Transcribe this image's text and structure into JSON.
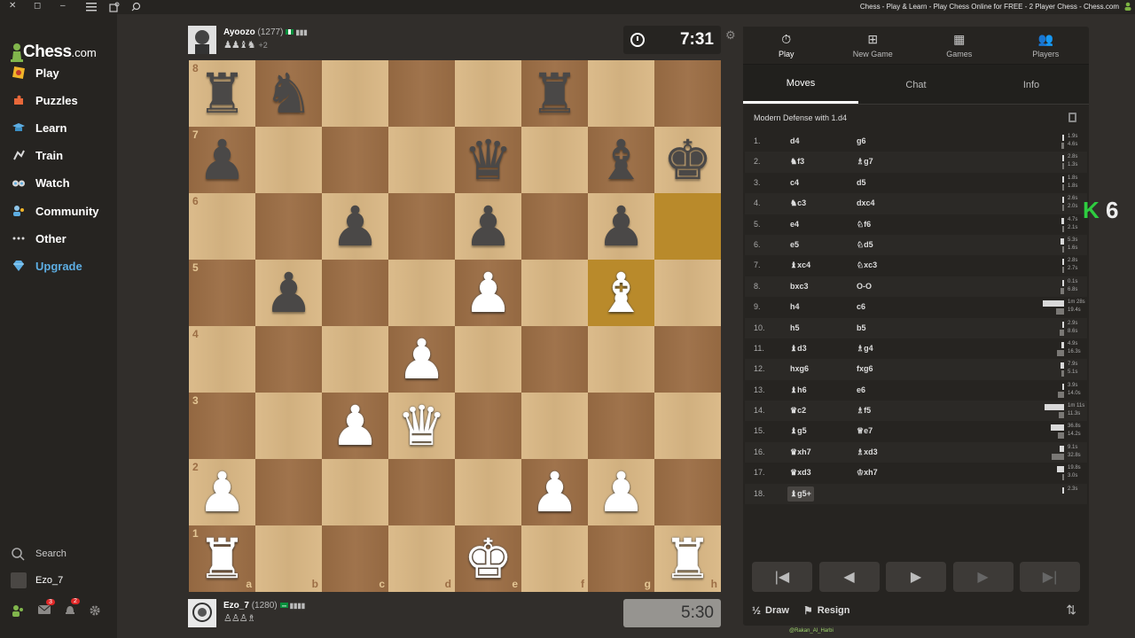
{
  "window": {
    "title": "Chess - Play & Learn - Play Chess Online for FREE - 2 Player Chess - Chess.com",
    "controls": [
      "✕",
      "◻",
      "–"
    ]
  },
  "sidebar": {
    "logo_text": "Chess",
    "logo_suffix": ".com",
    "items": [
      {
        "label": "Play",
        "icon": "play-icon",
        "color": "#f0b429"
      },
      {
        "label": "Puzzles",
        "icon": "puzzle-icon",
        "color": "#e8683a"
      },
      {
        "label": "Learn",
        "icon": "learn-icon",
        "color": "#5dade2"
      },
      {
        "label": "Train",
        "icon": "train-icon",
        "color": "#d9d9d9"
      },
      {
        "label": "Watch",
        "icon": "watch-icon",
        "color": "#d9d9d9"
      },
      {
        "label": "Community",
        "icon": "community-icon",
        "color": "#8ec5e8"
      },
      {
        "label": "Other",
        "icon": "more-icon",
        "color": "#d9d9d9"
      },
      {
        "label": "Upgrade",
        "icon": "diamond-icon",
        "color": "#5dade2"
      }
    ],
    "search_label": "Search",
    "user_label": "Ezo_7",
    "mail_badge": "3",
    "notif_badge": "2"
  },
  "top_player": {
    "name": "Ayoozo",
    "rating": "(1277)",
    "captured": "♟♟♝♞",
    "advantage": "+2",
    "clock": "7:31"
  },
  "bottom_player": {
    "name": "Ezo_7",
    "rating": "(1280)",
    "captured": "♙♙♙♗",
    "clock": "5:30"
  },
  "board": {
    "files": [
      "a",
      "b",
      "c",
      "d",
      "e",
      "f",
      "g",
      "h"
    ],
    "ranks": [
      "8",
      "7",
      "6",
      "5",
      "4",
      "3",
      "2",
      "1"
    ],
    "highlight": [
      "h6",
      "g5"
    ],
    "pieces": [
      {
        "sq": "a8",
        "p": "r"
      },
      {
        "sq": "b8",
        "p": "n"
      },
      {
        "sq": "f8",
        "p": "r"
      },
      {
        "sq": "a7",
        "p": "p"
      },
      {
        "sq": "e7",
        "p": "q"
      },
      {
        "sq": "g7",
        "p": "b"
      },
      {
        "sq": "h7",
        "p": "k"
      },
      {
        "sq": "c6",
        "p": "p"
      },
      {
        "sq": "e6",
        "p": "p"
      },
      {
        "sq": "g6",
        "p": "p"
      },
      {
        "sq": "b5",
        "p": "p"
      },
      {
        "sq": "e5",
        "p": "P"
      },
      {
        "sq": "g5",
        "p": "B"
      },
      {
        "sq": "d4",
        "p": "P"
      },
      {
        "sq": "c3",
        "p": "P"
      },
      {
        "sq": "d3",
        "p": "Q"
      },
      {
        "sq": "a2",
        "p": "P"
      },
      {
        "sq": "f2",
        "p": "P"
      },
      {
        "sq": "g2",
        "p": "P"
      },
      {
        "sq": "a1",
        "p": "R"
      },
      {
        "sq": "e1",
        "p": "K"
      },
      {
        "sq": "h1",
        "p": "R"
      }
    ]
  },
  "panel": {
    "tabs": [
      {
        "label": "Play",
        "icon": "stopwatch-icon"
      },
      {
        "label": "New Game",
        "icon": "plus-icon"
      },
      {
        "label": "Games",
        "icon": "board-icon"
      },
      {
        "label": "Players",
        "icon": "players-icon"
      }
    ],
    "subtabs": [
      "Moves",
      "Chat",
      "Info"
    ],
    "opening": "Modern Defense with 1.d4",
    "moves": [
      {
        "n": "1.",
        "w": "d4",
        "b": "g6",
        "tw": "1.9s",
        "tb": "4.6s",
        "bw": 0.02,
        "bb": 0.05
      },
      {
        "n": "2.",
        "w": "♞f3",
        "b": "♗g7",
        "tw": "2.8s",
        "tb": "1.3s",
        "bw": 0.03,
        "bb": 0.02
      },
      {
        "n": "3.",
        "w": "c4",
        "b": "d5",
        "tw": "1.8s",
        "tb": "1.8s",
        "bw": 0.02,
        "bb": 0.02
      },
      {
        "n": "4.",
        "w": "♞c3",
        "b": "dxc4",
        "tw": "2.6s",
        "tb": "2.0s",
        "bw": 0.03,
        "bb": 0.02
      },
      {
        "n": "5.",
        "w": "e4",
        "b": "♘f6",
        "tw": "4.7s",
        "tb": "2.1s",
        "bw": 0.05,
        "bb": 0.02
      },
      {
        "n": "6.",
        "w": "e5",
        "b": "♘d5",
        "tw": "5.3s",
        "tb": "1.6s",
        "bw": 0.06,
        "bb": 0.02
      },
      {
        "n": "7.",
        "w": "♝xc4",
        "b": "♘xc3",
        "tw": "2.8s",
        "tb": "2.7s",
        "bw": 0.03,
        "bb": 0.03
      },
      {
        "n": "8.",
        "w": "bxc3",
        "b": "O-O",
        "tw": "0.1s",
        "tb": "6.8s",
        "bw": 0.01,
        "bb": 0.07
      },
      {
        "n": "9.",
        "w": "h4",
        "b": "c6",
        "tw": "1m 28s",
        "tb": "19.4s",
        "bw": 0.4,
        "bb": 0.15
      },
      {
        "n": "10.",
        "w": "h5",
        "b": "b5",
        "tw": "2.9s",
        "tb": "8.6s",
        "bw": 0.03,
        "bb": 0.08
      },
      {
        "n": "11.",
        "w": "♝d3",
        "b": "♗g4",
        "tw": "4.9s",
        "tb": "16.3s",
        "bw": 0.05,
        "bb": 0.13
      },
      {
        "n": "12.",
        "w": "hxg6",
        "b": "fxg6",
        "tw": "7.9s",
        "tb": "5.1s",
        "bw": 0.07,
        "bb": 0.05
      },
      {
        "n": "13.",
        "w": "♝h6",
        "b": "e6",
        "tw": "3.9s",
        "tb": "14.0s",
        "bw": 0.04,
        "bb": 0.12
      },
      {
        "n": "14.",
        "w": "♛c2",
        "b": "♗f5",
        "tw": "1m 11s",
        "tb": "11.3s",
        "bw": 0.36,
        "bb": 0.1
      },
      {
        "n": "15.",
        "w": "♝g5",
        "b": "♕e7",
        "tw": "36.8s",
        "tb": "14.2s",
        "bw": 0.25,
        "bb": 0.12
      },
      {
        "n": "16.",
        "w": "♛xh7",
        "b": "♗xd3",
        "tw": "9.1s",
        "tb": "32.8s",
        "bw": 0.08,
        "bb": 0.23
      },
      {
        "n": "17.",
        "w": "♛xd3",
        "b": "♔xh7",
        "tw": "19.8s",
        "tb": "3.0s",
        "bw": 0.14,
        "bb": 0.03
      },
      {
        "n": "18.",
        "w": "♝g5+",
        "b": "",
        "tw": "2.3s",
        "tb": "",
        "bw": 0.0,
        "bb": 0.0
      }
    ],
    "controls": [
      "|◀",
      "◀",
      "▶",
      "▶",
      "▶|"
    ],
    "draw_label": "Draw",
    "resign_label": "Resign"
  },
  "overlay": {
    "k": "K",
    "num": "6"
  },
  "footer_tag": "@Rakan_Al_Harbi"
}
